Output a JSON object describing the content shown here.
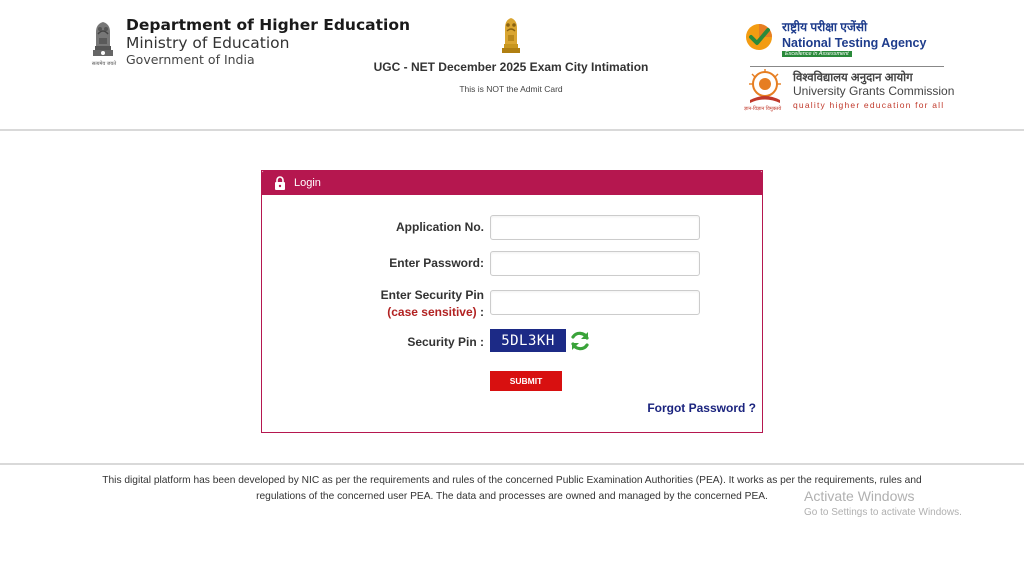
{
  "header": {
    "dhe": {
      "title": "Department of Higher Education",
      "ministry": "Ministry of Education",
      "government": "Government of India",
      "emblem_motto": "सत्यमेव जयते"
    },
    "center": {
      "title": "UGC - NET December 2025 Exam City Intimation",
      "subtitle": "This is NOT the Admit Card"
    },
    "nta": {
      "hindi": "राष्ट्रीय परीक्षा एजेंसी",
      "name": "National Testing Agency",
      "tagline": "Excellence in Assessment"
    },
    "ugc": {
      "hindi": "विश्वविद्यालय अनुदान आयोग",
      "name": "University Grants Commission",
      "tagline": "quality higher education for all",
      "logo_hindi": "ज्ञान-विज्ञान विमुक्तये"
    }
  },
  "login": {
    "header_label": "Login",
    "application_label": "Application No.",
    "application_value": "",
    "password_label": "Enter Password:",
    "password_value": "",
    "security_pin_label": "Enter Security Pin",
    "case_note": "(case sensitive)",
    "case_colon": " :",
    "security_pin_value": "",
    "captcha_label": "Security Pin :",
    "captcha_value": "5DL3KH",
    "submit_label": "SUBMIT",
    "forgot_label": "Forgot Password ?"
  },
  "footer": {
    "text": "This digital platform has been developed by NIC as per the requirements and rules of the concerned Public Examination Authorities (PEA). It works as per the requirements, rules and regulations of the concerned user PEA. The data and processes are owned and managed by the concerned PEA."
  },
  "watermark": {
    "title": "Activate Windows",
    "subtitle": "Go to Settings to activate Windows."
  },
  "colors": {
    "panel_accent": "#b5174f",
    "submit": "#d81010",
    "captcha_bg": "#1c2a86",
    "link": "#1a237e"
  }
}
